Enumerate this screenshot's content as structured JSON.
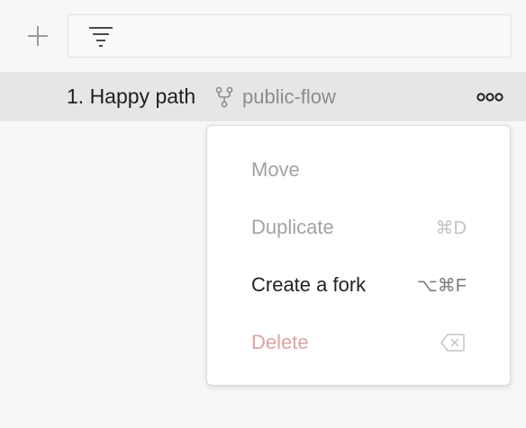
{
  "toolbar": {
    "add_icon": "plus-icon",
    "filter_icon": "filter-lines-icon",
    "filter_value": ""
  },
  "flow": {
    "title": "1. Happy path",
    "branch_icon": "fork-icon",
    "branch": "public-flow",
    "more_icon": "more-dots-icon"
  },
  "menu": {
    "items": [
      {
        "label": "Move",
        "shortcut": "",
        "state": "disabled"
      },
      {
        "label": "Duplicate",
        "shortcut": "⌘D",
        "state": "disabled"
      },
      {
        "label": "Create a fork",
        "shortcut": "⌥⌘F",
        "state": "enabled"
      },
      {
        "label": "Delete",
        "shortcut_icon": "backspace-icon",
        "state": "disabled"
      }
    ]
  },
  "colors": {
    "row_highlight": "#e6e6e6",
    "delete_text": "#dba3a3"
  }
}
